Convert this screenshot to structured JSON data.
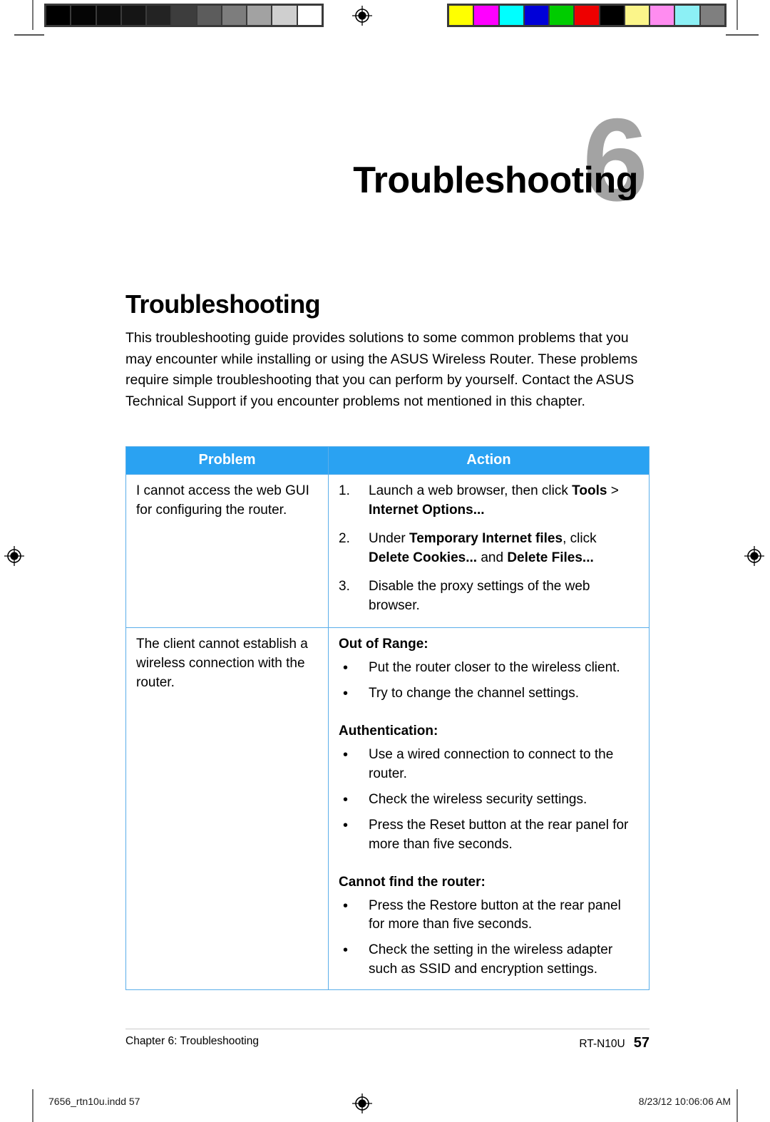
{
  "chapter": {
    "number": "6",
    "title": "Troubleshooting"
  },
  "section": {
    "title": "Troubleshooting",
    "intro": "This troubleshooting guide provides solutions to some common problems that you may encounter while installing or using the ASUS Wireless Router. These problems require simple troubleshooting that you can perform by yourself. Contact the ASUS Technical Support if you encounter problems not mentioned in this chapter."
  },
  "table": {
    "headers": {
      "problem": "Problem",
      "action": "Action"
    },
    "row1": {
      "problem": "I cannot access the web GUI for configuring the router.",
      "steps": [
        {
          "num": "1.",
          "text_pre": "Launch a web browser, then click ",
          "bold1": "Tools",
          "mid1": " > ",
          "bold2": "Internet Options...",
          "post": ""
        },
        {
          "num": "2.",
          "text_pre": "Under ",
          "bold1": "Temporary Internet files",
          "mid1": ", click ",
          "bold2": "Delete Cookies...",
          "mid2": " and ",
          "bold3": "Delete Files...",
          "post": ""
        },
        {
          "num": "3.",
          "text_pre": "Disable the proxy settings of the web browser.",
          "bold1": "",
          "mid1": "",
          "bold2": "",
          "post": ""
        }
      ]
    },
    "row2": {
      "problem": "The client cannot establish a wireless connection with the router.",
      "groups": [
        {
          "heading": "Out of Range:",
          "bullets": [
            "Put the router closer to the wireless client.",
            "Try to change the channel settings."
          ]
        },
        {
          "heading": "Authentication:",
          "bullets": [
            "Use a wired connection to connect to the router.",
            "Check the wireless security settings.",
            "Press the Reset button at the rear panel for more than five seconds."
          ]
        },
        {
          "heading": "Cannot find the router:",
          "bullets": [
            "Press the Restore button at the rear panel for more than five seconds.",
            "Check the setting in the wireless adapter such as SSID and encryption settings."
          ]
        }
      ]
    }
  },
  "footer": {
    "chapter_label": "Chapter 6: Troubleshooting",
    "model": "RT-N10U",
    "page_number": "57"
  },
  "print_marks": {
    "file_name": "7656_rtn10u.indd   57",
    "timestamp": "8/23/12   10:06:06 AM",
    "bullet_glyph": "•",
    "grayscale_patches": [
      "#000000",
      "#050505",
      "#0c0c0c",
      "#151515",
      "#232323",
      "#3d3d3d",
      "#5c5c5c",
      "#7d7d7d",
      "#a2a2a2",
      "#cfcfcf",
      "#ffffff"
    ],
    "color_patches": [
      "#ffff00",
      "#ff00ff",
      "#00ffff",
      "#0000d8",
      "#00cc00",
      "#ee0000",
      "#000000",
      "#fbf58a",
      "#ff8cf0",
      "#8cf0f5",
      "#7f7f7f"
    ]
  },
  "colors": {
    "header_blue": "#2aa2f2",
    "border_blue": "#5aaeea",
    "chapter_gray": "#a3a3a3"
  }
}
